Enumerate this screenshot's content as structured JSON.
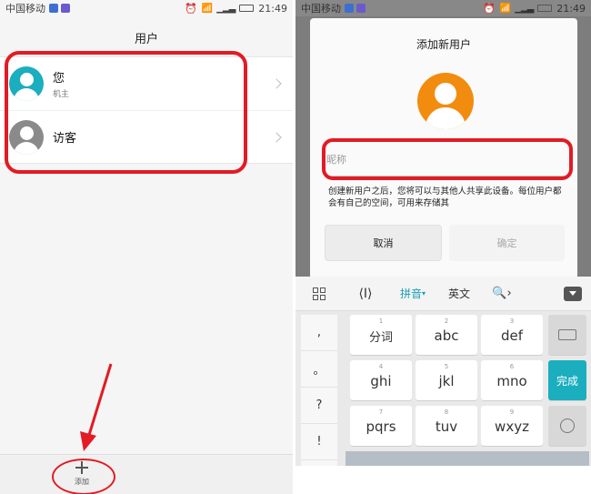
{
  "left_screen": {
    "status": {
      "carrier": "中国移动",
      "time": "21:49"
    },
    "title": "用户",
    "users": [
      {
        "name": "您",
        "sub": "机主"
      },
      {
        "name": "访客",
        "sub": ""
      }
    ],
    "add_label": "添加"
  },
  "right_screen": {
    "status": {
      "carrier": "中国移动",
      "time": "21:49"
    },
    "dialog": {
      "title": "添加新用户",
      "nickname_placeholder": "昵称",
      "description": "创建新用户之后，您将可以与其他人共享此设备。每位用户都会有自己的空间，可用来存储其",
      "cancel_label": "取消",
      "confirm_label": "确定"
    },
    "ime_bar": {
      "pinyin": "拼音",
      "english": "英文"
    },
    "keys": [
      {
        "num": "1",
        "label": "分词"
      },
      {
        "num": "2",
        "label": "abc"
      },
      {
        "num": "3",
        "label": "def"
      },
      {
        "num": "4",
        "label": "ghi"
      },
      {
        "num": "5",
        "label": "jkl"
      },
      {
        "num": "6",
        "label": "mno"
      },
      {
        "num": "7",
        "label": "pqrs"
      },
      {
        "num": "8",
        "label": "tuv"
      },
      {
        "num": "9",
        "label": "wxyz"
      }
    ],
    "punct": [
      ",",
      "。",
      "?",
      "!"
    ],
    "done_label": "完成"
  },
  "colors": {
    "annotation_red": "#e21b24",
    "teal_accent": "#1aaebf",
    "orange_avatar": "#f28c0f"
  }
}
